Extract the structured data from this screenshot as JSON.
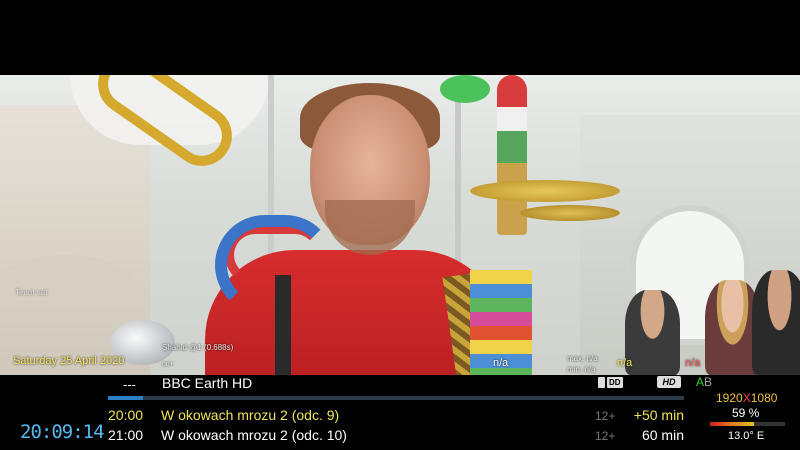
{
  "overlay": {
    "cam_text": "Team sat",
    "date": "Saturday 25 April 2020",
    "shahid": "Shahid @1 (0.688s)",
    "nc": "nc+",
    "na_mid": "n/a",
    "max_label": "max. n/a",
    "min_label": "min. n/a",
    "na_yellow": "n/a",
    "na_red": "n/a"
  },
  "channel": {
    "number": "---",
    "name": "BBC Earth HD",
    "progress": 0.06
  },
  "clock": "20:09:14",
  "events": [
    {
      "time": "20:00",
      "title": "W okowach mrozu 2 (odc. 9)",
      "age": "12+",
      "duration": "+50 min"
    },
    {
      "time": "21:00",
      "title": "W okowach mrozu 2 (odc. 10)",
      "age": "12+",
      "duration": "60 min"
    }
  ],
  "badges": {
    "dolby": "DD",
    "hd": "HD",
    "audio_a": "A",
    "audio_b": "B"
  },
  "tech": {
    "res_w": "1920",
    "res_x": "X",
    "res_h": "1080",
    "signal": "59 %",
    "signal_level": 0.59,
    "satellite": "13.0° E"
  },
  "colors": {
    "accent_blue": "#55b8ee",
    "current_event": "#f2e25a",
    "resolution": "#f0c040"
  }
}
